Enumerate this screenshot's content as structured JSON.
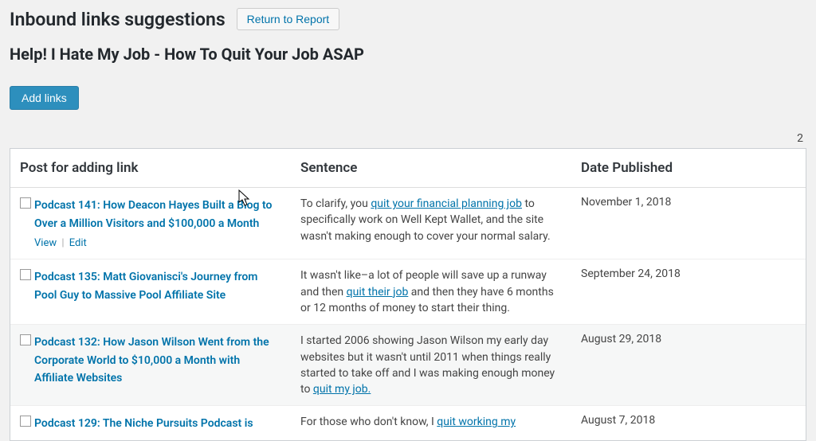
{
  "header": {
    "title": "Inbound links suggestions",
    "return_label": "Return to Report",
    "post_title": "Help! I Hate My Job - How To Quit Your Job ASAP"
  },
  "actions": {
    "add_links_label": "Add links",
    "count_fragment": "2"
  },
  "columns": {
    "post": "Post for adding link",
    "sentence": "Sentence",
    "date": "Date Published"
  },
  "row_actions": {
    "view": "View",
    "edit": "Edit"
  },
  "rows": [
    {
      "post": "Podcast 141: How Deacon Hayes Built a Blog to Over a Million Visitors and $100,000 a Month",
      "sentence_pre": "To clarify, you ",
      "sentence_link": "quit your financial planning job",
      "sentence_post": " to specifically work on Well Kept Wallet, and the site wasn't making enough to cover your normal salary.",
      "date": "November 1, 2018",
      "show_actions": true
    },
    {
      "post": "Podcast 135: Matt Giovanisci's Journey from Pool Guy to Massive Pool Affiliate Site",
      "sentence_pre": "It wasn't like–a lot of people will save up a runway and then ",
      "sentence_link": "quit their job",
      "sentence_post": " and then they have 6 months or 12 months of money to start their thing.",
      "date": "September 24, 2018",
      "show_actions": false
    },
    {
      "post": "Podcast 132: How Jason Wilson Went from the Corporate World to $10,000 a Month with Affiliate Websites",
      "sentence_pre": "I started 2006 showing Jason Wilson my early day websites but it wasn't until 2011 when things really started to take off and I was making enough money to ",
      "sentence_link": "quit my job.",
      "sentence_post": "",
      "date": "August 29, 2018",
      "show_actions": false
    },
    {
      "post": "Podcast 129: The Niche Pursuits Podcast is",
      "sentence_pre": "For those who don't know, I ",
      "sentence_link": "quit working my",
      "sentence_post": "",
      "date": "August 7, 2018",
      "show_actions": false
    }
  ]
}
